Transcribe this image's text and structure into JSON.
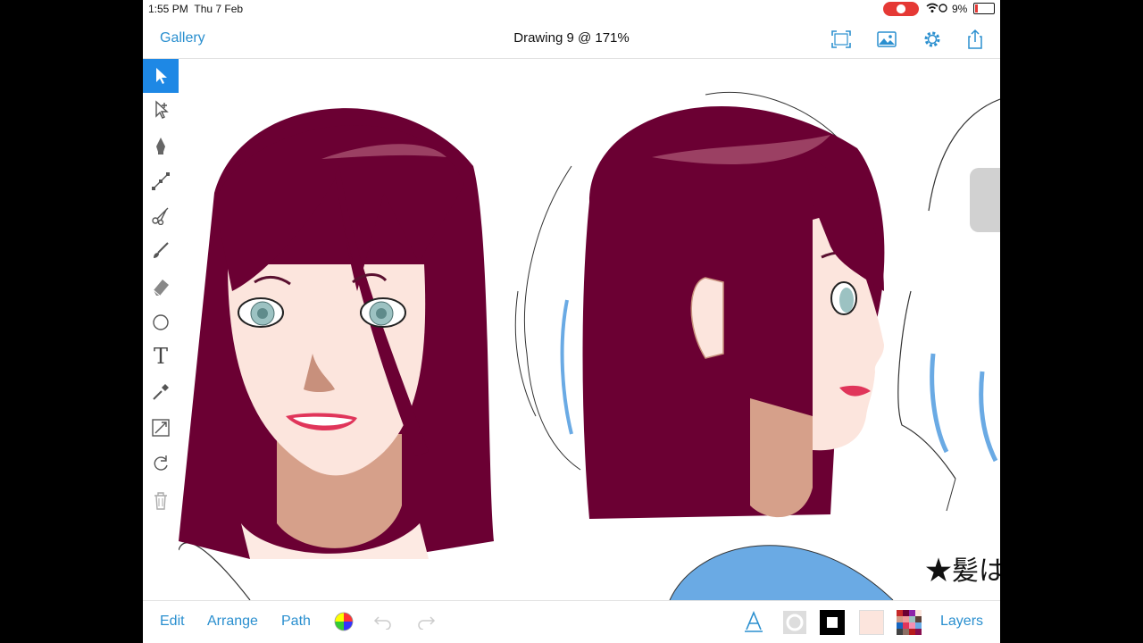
{
  "status_bar": {
    "time": "1:55 PM",
    "date": "Thu 7 Feb",
    "battery": "9%"
  },
  "nav": {
    "gallery": "Gallery",
    "title": "Drawing 9 @ 171%"
  },
  "bottom": {
    "edit": "Edit",
    "arrange": "Arrange",
    "path": "Path",
    "layers": "Layers"
  },
  "canvas": {
    "note": "★髪は全"
  },
  "colors": {
    "accent": "#2a8fcf",
    "hair": "#6b0033",
    "skin": "#fce5dd",
    "skin_shadow": "#d29a86",
    "eye": "#9cc2c2",
    "blue_sketch": "#6aaae4"
  },
  "icons": [
    "select-arrow-icon",
    "subselect-arrow-icon",
    "pen-icon",
    "node-icon",
    "scissors-icon",
    "brush-icon",
    "eraser-icon",
    "shape-icon",
    "text-icon",
    "eyedropper-icon",
    "transform-icon",
    "rotate-icon",
    "trash-icon",
    "fullscreen-icon",
    "image-icon",
    "settings-icon",
    "share-icon",
    "undo-icon",
    "redo-icon",
    "color-wheel-icon",
    "text-style-icon",
    "stroke-icon"
  ]
}
